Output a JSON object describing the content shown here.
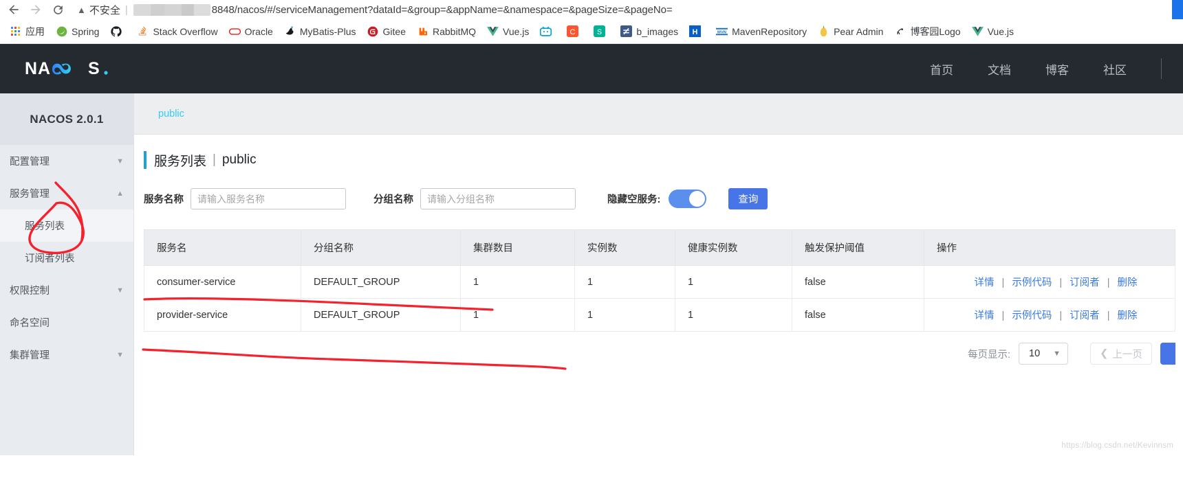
{
  "browser": {
    "back_icon": "back-arrow-icon",
    "forward_icon": "forward-arrow-icon",
    "reload_icon": "reload-icon",
    "security_warning_icon": "warning-triangle-icon",
    "security_label": "不安全",
    "url_text": "8848/nacos/#/serviceManagement?dataId=&group=&appName=&namespace=&pageSize=&pageNo=",
    "bookmarks": [
      {
        "label": "应用",
        "icon": "apps-grid-icon"
      },
      {
        "label": "Spring",
        "icon": "spring-leaf-icon"
      },
      {
        "label": "",
        "icon": "github-icon"
      },
      {
        "label": "Stack Overflow",
        "icon": "stackoverflow-icon"
      },
      {
        "label": "Oracle",
        "icon": "oracle-icon"
      },
      {
        "label": "MyBatis-Plus",
        "icon": "mybatis-bird-icon"
      },
      {
        "label": "Gitee",
        "icon": "gitee-icon"
      },
      {
        "label": "RabbitMQ",
        "icon": "rabbitmq-icon"
      },
      {
        "label": "Vue.js",
        "icon": "vuejs-icon"
      },
      {
        "label": "",
        "icon": "bilibili-icon"
      },
      {
        "label": "",
        "icon": "csdn-icon"
      },
      {
        "label": "",
        "icon": "segmentfault-icon"
      },
      {
        "label": "b_images",
        "icon": "b-images-icon"
      },
      {
        "label": "",
        "icon": "h-blue-icon"
      },
      {
        "label": "MavenRepository",
        "icon": "maven-icon"
      },
      {
        "label": "Pear Admin",
        "icon": "pear-icon"
      },
      {
        "label": "博客园Logo",
        "icon": "cnblogs-icon"
      },
      {
        "label": "Vue.js",
        "icon": "vuejs-icon"
      }
    ]
  },
  "nacos_header": {
    "logo_text": "NACOS.",
    "nav": [
      {
        "label": "首页"
      },
      {
        "label": "文档"
      },
      {
        "label": "博客"
      },
      {
        "label": "社区"
      }
    ]
  },
  "sidebar": {
    "title": "NACOS 2.0.1",
    "items": [
      {
        "label": "配置管理",
        "chevron": "chevron-down-icon",
        "sub": false,
        "active": false
      },
      {
        "label": "服务管理",
        "chevron": "chevron-up-icon",
        "sub": false,
        "active": false
      },
      {
        "label": "服务列表",
        "chevron": "",
        "sub": true,
        "active": true
      },
      {
        "label": "订阅者列表",
        "chevron": "",
        "sub": true,
        "active": false
      },
      {
        "label": "权限控制",
        "chevron": "chevron-down-icon",
        "sub": false,
        "active": false
      },
      {
        "label": "命名空间",
        "chevron": "",
        "sub": false,
        "active": false
      },
      {
        "label": "集群管理",
        "chevron": "chevron-down-icon",
        "sub": false,
        "active": false
      }
    ]
  },
  "main": {
    "breadcrumb": "public",
    "title": "服务列表",
    "title_sep": "|",
    "title_namespace": "public",
    "filters": {
      "service_name_label": "服务名称",
      "service_name_value": "",
      "service_name_placeholder": "请输入服务名称",
      "group_name_label": "分组名称",
      "group_name_value": "",
      "group_name_placeholder": "请输入分组名称",
      "hide_empty_label": "隐藏空服务:",
      "hide_empty_on": true,
      "query_button": "查询"
    },
    "table": {
      "columns": [
        "服务名",
        "分组名称",
        "集群数目",
        "实例数",
        "健康实例数",
        "触发保护阈值",
        "操作"
      ],
      "rows": [
        {
          "service": "consumer-service",
          "group": "DEFAULT_GROUP",
          "clusters": "1",
          "instances": "1",
          "healthy": "1",
          "threshold": "false",
          "ops": [
            "详情",
            "示例代码",
            "订阅者",
            "删除"
          ]
        },
        {
          "service": "provider-service",
          "group": "DEFAULT_GROUP",
          "clusters": "1",
          "instances": "1",
          "healthy": "1",
          "threshold": "false",
          "ops": [
            "详情",
            "示例代码",
            "订阅者",
            "删除"
          ]
        }
      ]
    },
    "pagination": {
      "page_size_label": "每页显示:",
      "page_size_value": "10",
      "prev_label": "上一页",
      "prev_icon": "chevron-left-icon",
      "next_icon": "chevron-right-icon"
    },
    "watermark": "https://blog.csdn.net/Kevinnsm"
  },
  "colors": {
    "brand_dark": "#252a30",
    "accent_blue": "#4774e6",
    "link_blue": "#3b7ae0",
    "breadcrumb_cyan": "#33cbff",
    "annotation_red": "#f5212d"
  }
}
